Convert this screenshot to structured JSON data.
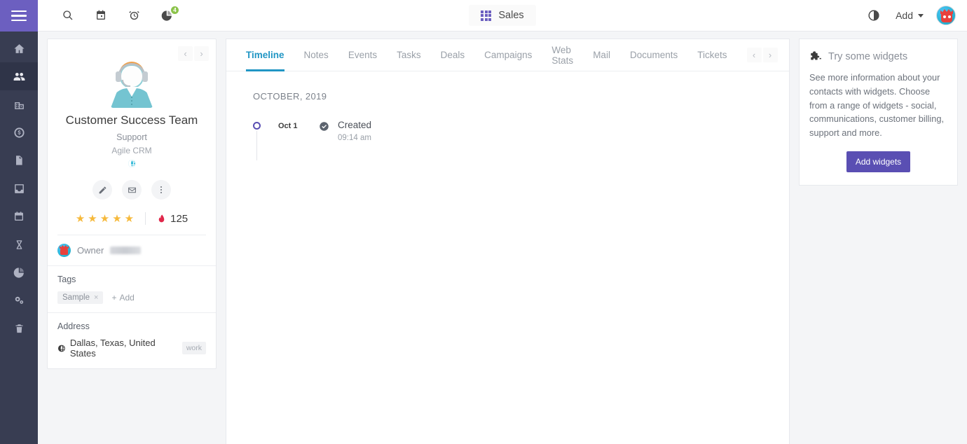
{
  "topbar": {
    "menu_icon": "hamburger-icon",
    "icons": [
      {
        "name": "search-icon",
        "badge": null
      },
      {
        "name": "calendar-icon",
        "badge": null
      },
      {
        "name": "alarm-clock-icon",
        "badge": null
      },
      {
        "name": "reports-pie-icon",
        "badge": "4"
      }
    ],
    "app_switcher": {
      "icon": "grid-icon",
      "label": "Sales"
    },
    "moon_icon": "moon-icon",
    "add_label": "Add",
    "avatar": "user-avatar"
  },
  "sidebar": {
    "items": [
      {
        "name": "sidebar-item-home",
        "icon": "home-icon",
        "active": false
      },
      {
        "name": "sidebar-item-contacts",
        "icon": "contacts-icon",
        "active": true
      },
      {
        "name": "sidebar-item-companies",
        "icon": "company-icon",
        "active": false
      },
      {
        "name": "sidebar-item-deals",
        "icon": "dollar-coin-icon",
        "active": false
      },
      {
        "name": "sidebar-item-documents",
        "icon": "document-icon",
        "active": false
      },
      {
        "name": "sidebar-item-inbox",
        "icon": "inbox-icon",
        "active": false
      },
      {
        "name": "sidebar-item-calendar",
        "icon": "calendar-icon",
        "active": false
      },
      {
        "name": "sidebar-item-workflows",
        "icon": "hourglass-icon",
        "active": false
      },
      {
        "name": "sidebar-item-reports",
        "icon": "pie-chart-icon",
        "active": false
      },
      {
        "name": "sidebar-item-settings",
        "icon": "gears-icon",
        "active": false
      },
      {
        "name": "sidebar-item-trash",
        "icon": "trash-icon",
        "active": false
      }
    ]
  },
  "contact_card": {
    "prev_label": "‹",
    "next_label": "›",
    "avatar_icon": "support-agent-avatar",
    "name": "Customer Success Team",
    "role": "Support",
    "company": "Agile CRM",
    "website_icon": "globe-icon",
    "actions": [
      {
        "name": "edit-contact-button",
        "icon": "pencil-icon"
      },
      {
        "name": "email-contact-button",
        "icon": "envelope-icon"
      },
      {
        "name": "more-options-button",
        "icon": "vertical-dots-icon"
      }
    ],
    "stars": 5,
    "star_glyph": "★",
    "score_icon": "flame-icon",
    "score": "125",
    "owner_label": "Owner",
    "owner_value": "",
    "tags_title": "Tags",
    "tags": [
      {
        "label": "Sample",
        "remove": "×"
      }
    ],
    "add_tag_label": "Add",
    "address_title": "Address",
    "address_icon": "globe-icon",
    "address": "Dallas, Texas, United States",
    "address_type": "work"
  },
  "center": {
    "tabs": [
      {
        "label": "Timeline",
        "active": true
      },
      {
        "label": "Notes",
        "active": false
      },
      {
        "label": "Events",
        "active": false
      },
      {
        "label": "Tasks",
        "active": false
      },
      {
        "label": "Deals",
        "active": false
      },
      {
        "label": "Campaigns",
        "active": false
      },
      {
        "label": "Web Stats",
        "active": false
      },
      {
        "label": "Mail",
        "active": false
      },
      {
        "label": "Documents",
        "active": false
      },
      {
        "label": "Tickets",
        "active": false
      }
    ],
    "tabs_prev": "‹",
    "tabs_next": "›",
    "timeline": {
      "month": "OCTOBER, 2019",
      "entries": [
        {
          "date": "Oct 1",
          "status_icon": "check-circle-icon",
          "title": "Created",
          "time": "09:14 am"
        }
      ]
    }
  },
  "widgets_panel": {
    "icon": "puzzle-piece-icon",
    "title": "Try some widgets",
    "description": "See more information about your contacts with widgets. Choose from a range of widgets - social, communications, customer billing, support and more.",
    "button_label": "Add widgets"
  },
  "colors": {
    "brand_purple": "#6c5fc0",
    "sidebar_dark": "#383d52",
    "accent_blue": "#2196c4",
    "badge_green": "#8bc34a",
    "star_gold": "#f6b93b",
    "page_bg": "#f4f5f7"
  }
}
